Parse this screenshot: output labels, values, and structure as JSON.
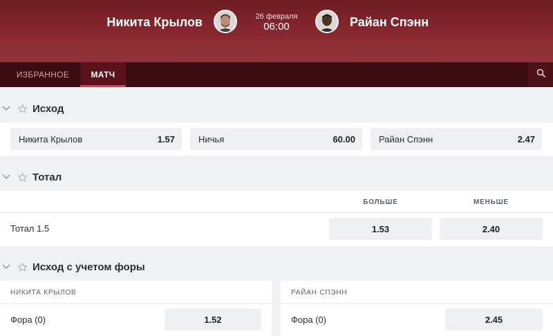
{
  "header": {
    "fighter_left": "Никита Крылов",
    "fighter_right": "Райан Спэнн",
    "date": "26 февраля",
    "time": "06:00"
  },
  "tabs": [
    {
      "label": "ИЗБРАННОЕ",
      "active": false
    },
    {
      "label": "МАТЧ",
      "active": true
    }
  ],
  "search": {
    "icon": "search-icon"
  },
  "outcome": {
    "title": "Исход",
    "options": [
      {
        "label": "Никита Крылов",
        "odd": "1.57"
      },
      {
        "label": "Ничья",
        "odd": "60.00"
      },
      {
        "label": "Райан Спэнн",
        "odd": "2.47"
      }
    ]
  },
  "total": {
    "title": "Тотал",
    "col_over": "БОЛЬШЕ",
    "col_under": "МЕНЬШЕ",
    "row_label": "Тотал 1.5",
    "over_odd": "1.53",
    "under_odd": "2.40"
  },
  "handicap": {
    "title": "Исход с учетом форы",
    "left": {
      "name": "НИКИТА КРЫЛОВ",
      "row_label": "Фора (0)",
      "odd": "1.52"
    },
    "right": {
      "name": "РАЙАН СПЭНН",
      "row_label": "Фора (0)",
      "odd": "2.45"
    }
  },
  "colors": {
    "header_top": "#6d1b22",
    "tabs_bg": "#3b0c12",
    "active_tab_underline": "#c8464f",
    "page_bg": "#f0f1f4",
    "odd_bg": "#eef0f4"
  }
}
